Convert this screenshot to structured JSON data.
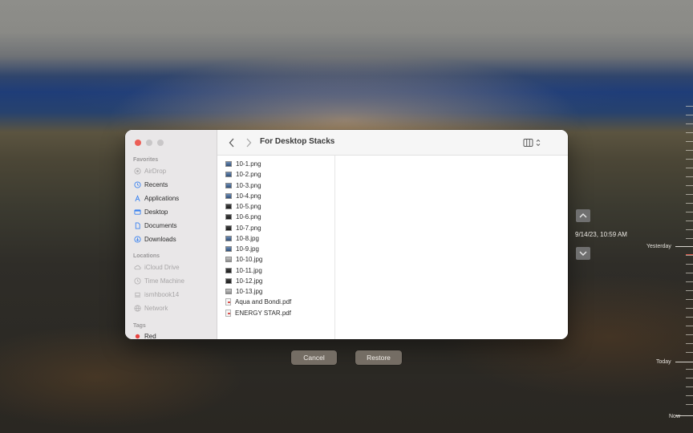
{
  "window": {
    "title": "For Desktop Stacks"
  },
  "sidebar": {
    "favorites_label": "Favorites",
    "favorites": [
      {
        "label": "AirDrop",
        "icon": "airdrop-icon",
        "dim": true
      },
      {
        "label": "Recents",
        "icon": "clock-icon",
        "dim": false
      },
      {
        "label": "Applications",
        "icon": "applications-icon",
        "dim": false
      },
      {
        "label": "Desktop",
        "icon": "desktop-icon",
        "dim": false
      },
      {
        "label": "Documents",
        "icon": "document-icon",
        "dim": false
      },
      {
        "label": "Downloads",
        "icon": "downloads-icon",
        "dim": false
      }
    ],
    "locations_label": "Locations",
    "locations": [
      {
        "label": "iCloud Drive",
        "icon": "cloud-icon"
      },
      {
        "label": "Time Machine",
        "icon": "time-machine-icon"
      },
      {
        "label": "ismhbook14",
        "icon": "laptop-icon"
      },
      {
        "label": "Network",
        "icon": "network-icon"
      }
    ],
    "tags_label": "Tags",
    "tags": [
      {
        "label": "Red",
        "color": "#e8423f"
      }
    ]
  },
  "files": [
    {
      "name": "10-1.png",
      "thumb": "blue"
    },
    {
      "name": "10-2.png",
      "thumb": "blue"
    },
    {
      "name": "10-3.png",
      "thumb": "blue"
    },
    {
      "name": "10-4.png",
      "thumb": "blue"
    },
    {
      "name": "10-5.png",
      "thumb": "dark"
    },
    {
      "name": "10-6.png",
      "thumb": "dark"
    },
    {
      "name": "10-7.png",
      "thumb": "dark"
    },
    {
      "name": "10-8.jpg",
      "thumb": "blue"
    },
    {
      "name": "10-9.jpg",
      "thumb": "blue"
    },
    {
      "name": "10-10.jpg",
      "thumb": "light"
    },
    {
      "name": "10-11.jpg",
      "thumb": "dark"
    },
    {
      "name": "10-12.jpg",
      "thumb": "dark"
    },
    {
      "name": "10-13.jpg",
      "thumb": "light"
    },
    {
      "name": "Aqua and Bondi.pdf",
      "thumb": "pdf"
    },
    {
      "name": "ENERGY STAR.pdf",
      "thumb": "pdf"
    }
  ],
  "buttons": {
    "cancel": "Cancel",
    "restore": "Restore"
  },
  "time_machine": {
    "current_date": "9/14/23, 10:59 AM",
    "timeline_labels": {
      "yesterday": "Yesterday",
      "today": "Today",
      "now": "Now"
    },
    "highlight_color": "#e05a4e"
  }
}
